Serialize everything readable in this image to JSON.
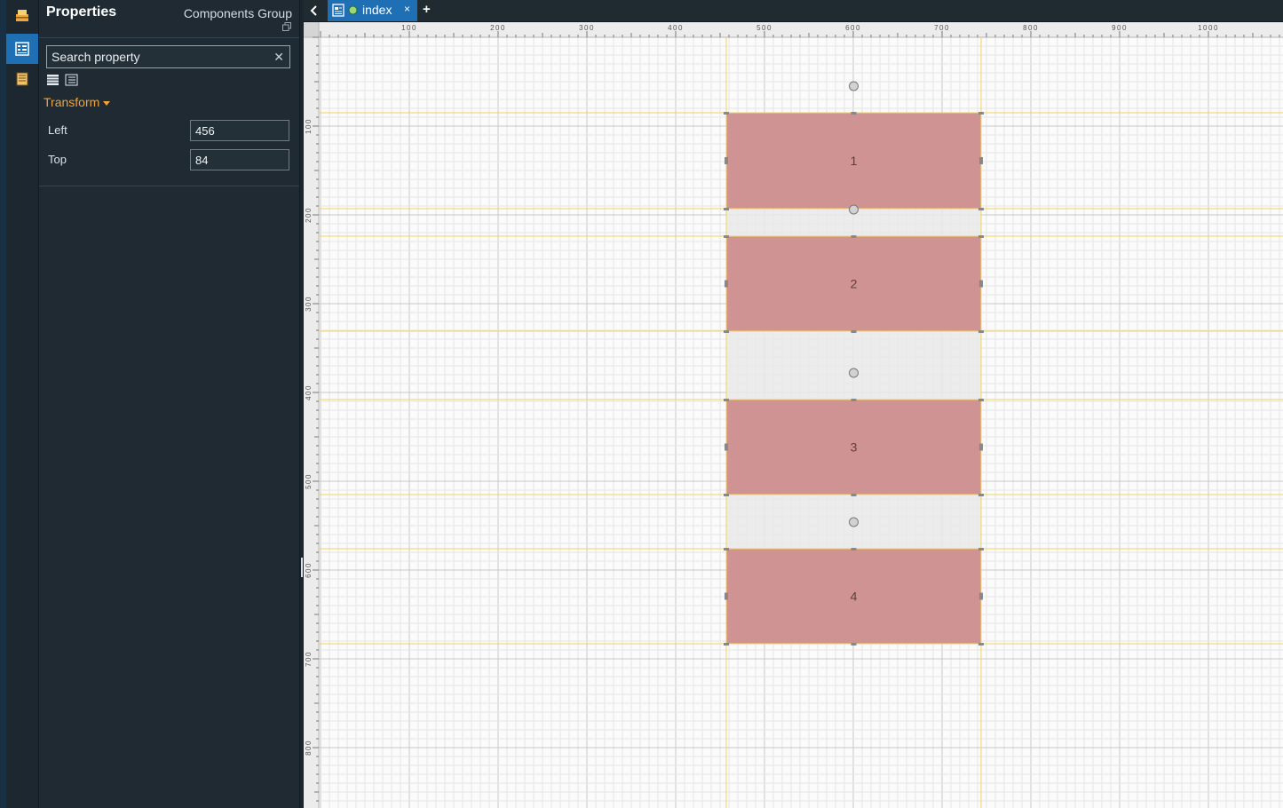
{
  "rail": {
    "items": [
      {
        "name": "components-icon",
        "active": false
      },
      {
        "name": "properties-icon",
        "active": true
      },
      {
        "name": "pages-icon",
        "active": false
      }
    ]
  },
  "properties": {
    "title": "Properties",
    "subtitle": "Components Group",
    "search_placeholder": "Search property",
    "section": "Transform",
    "fields": [
      {
        "label": "Left",
        "value": "456"
      },
      {
        "label": "Top",
        "value": "84"
      }
    ]
  },
  "tabs": {
    "items": [
      {
        "label": "index"
      }
    ],
    "add_label": "+",
    "close_label": "×"
  },
  "canvas": {
    "ruler_x_labels": [
      "100",
      "200",
      "300",
      "400",
      "500",
      "600",
      "700",
      "800",
      "900",
      "1000"
    ],
    "ruler_y_labels": [
      "100",
      "200",
      "300",
      "400",
      "500",
      "600",
      "700",
      "800"
    ],
    "components": [
      {
        "label": "1"
      },
      {
        "label": "2"
      },
      {
        "label": "3"
      },
      {
        "label": "4"
      }
    ],
    "component_color": "#cf9393",
    "spacer_color": "#e9e9e9",
    "guide_color": "#f3d35c"
  }
}
